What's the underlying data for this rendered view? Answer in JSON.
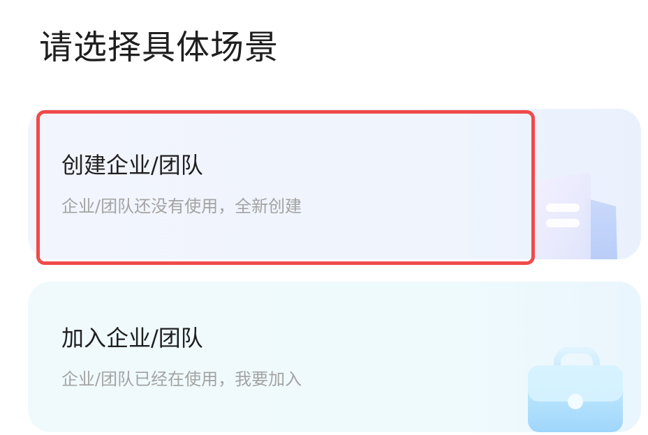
{
  "page": {
    "title": "请选择具体场景"
  },
  "cards": [
    {
      "title": "创建企业/团队",
      "subtitle": "企业/团队还没有使用，全新创建",
      "icon": "building-icon",
      "selected": true
    },
    {
      "title": "加入企业/团队",
      "subtitle": "企业/团队已经在使用，我要加入",
      "icon": "briefcase-icon",
      "selected": false
    }
  ],
  "colors": {
    "highlight": "#f04a4a",
    "title_text": "#1f1f1f",
    "subtitle_text": "#a3a3a3",
    "create_card_bg": "#eff4fd",
    "join_card_bg": "#effafd"
  }
}
